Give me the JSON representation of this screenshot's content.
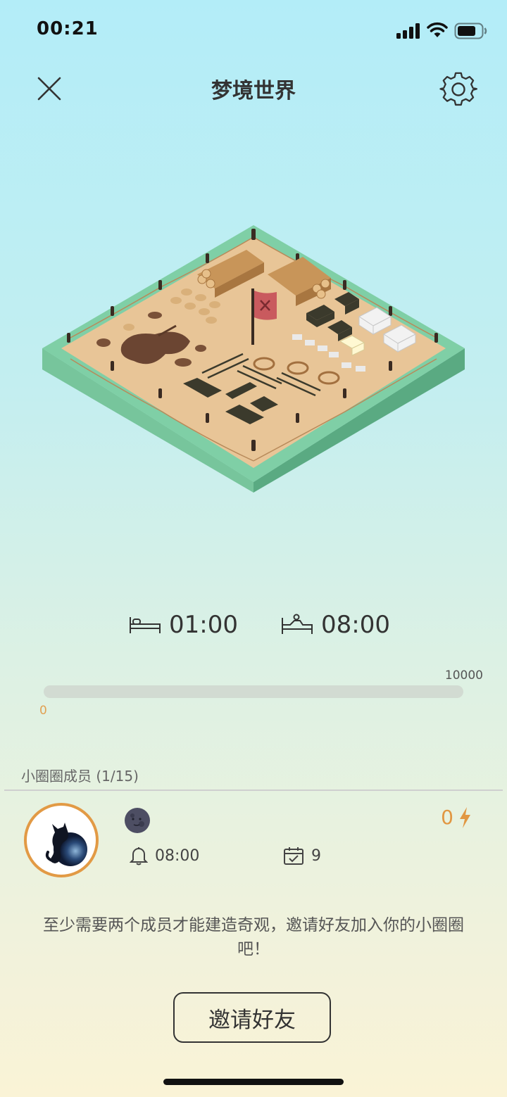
{
  "status_bar": {
    "time": "00:21"
  },
  "header": {
    "title": "梦境世界"
  },
  "sleep": {
    "bedtime": "01:00",
    "wake_time": "08:00"
  },
  "progress": {
    "min_label": "0",
    "max_label": "10000",
    "value": 0,
    "max": 10000
  },
  "members": {
    "title": "小圈圈成员 (1/15)",
    "list": [
      {
        "alarm_time": "08:00",
        "days": "9",
        "energy": "0"
      }
    ]
  },
  "hint_text": "至少需要两个成员才能建造奇观，邀请好友加入你的小圈圈吧！",
  "invite_button": "邀请好友",
  "colors": {
    "accent": "#e29a45",
    "text": "#333333",
    "sand": "#e8c597",
    "grass": "#7fcfa6"
  },
  "icons": [
    "close-icon",
    "gear-icon",
    "bed-icon",
    "wake-bed-icon",
    "signal-icon",
    "wifi-icon",
    "battery-icon",
    "moon-icon",
    "lightning-icon",
    "bell-icon",
    "calendar-check-icon"
  ]
}
